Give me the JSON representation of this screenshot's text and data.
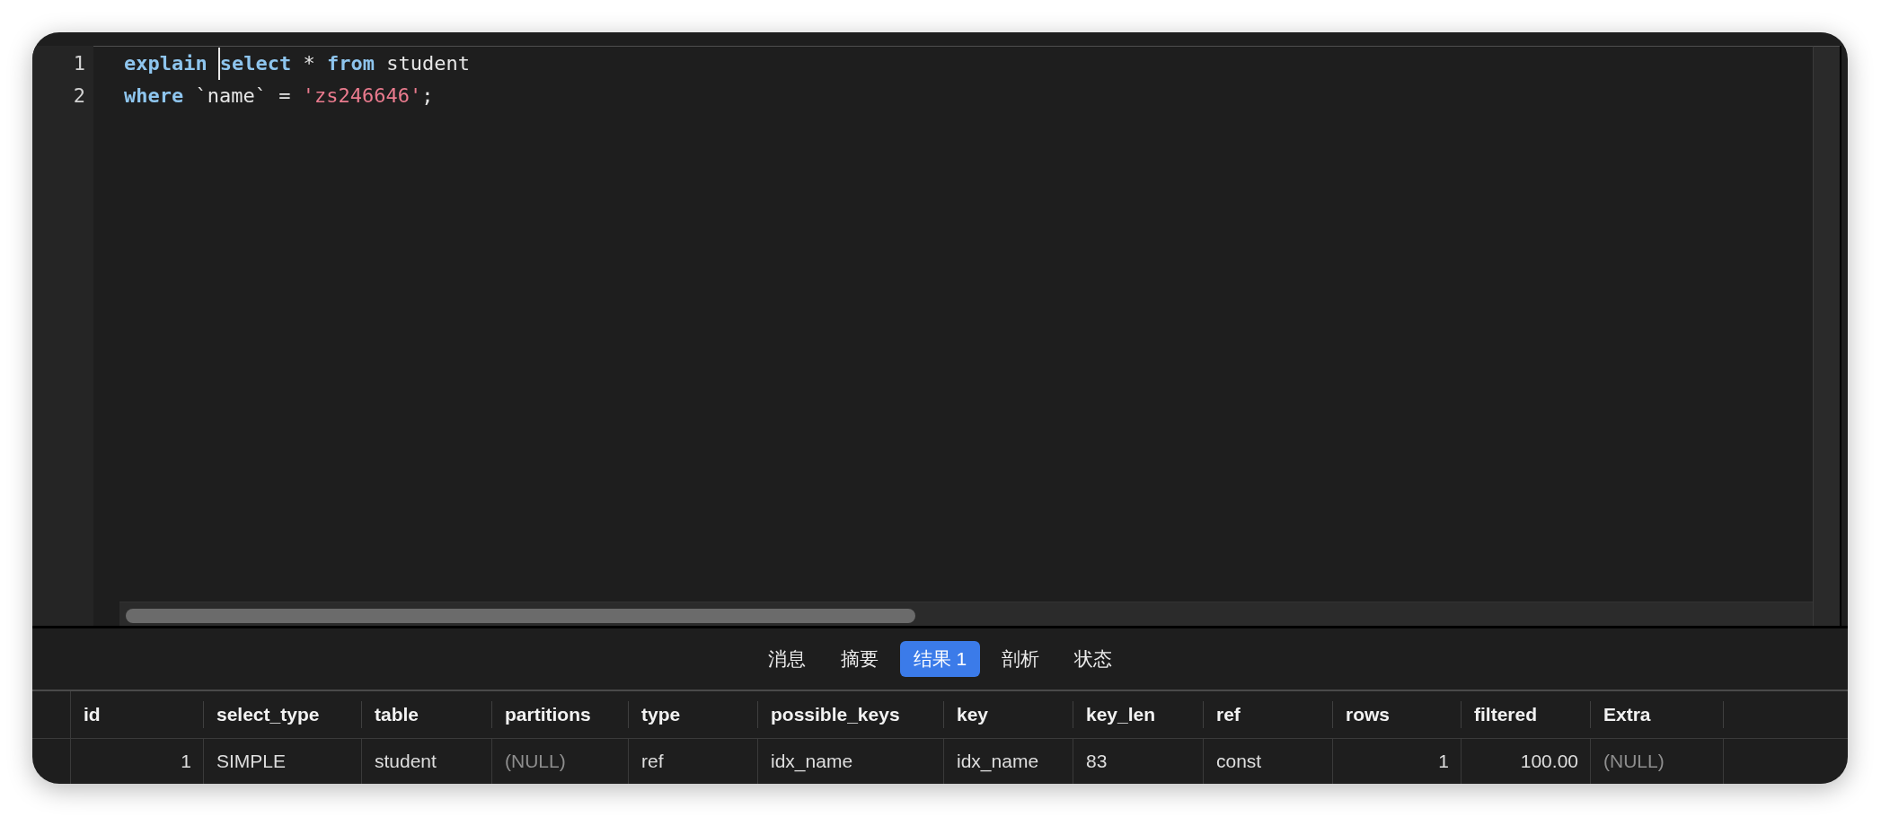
{
  "editor": {
    "lines": [
      {
        "number": "1",
        "tokens": [
          {
            "kind": "keyword",
            "text": "explain"
          },
          {
            "kind": "cursor"
          },
          {
            "kind": "keyword",
            "text": "select"
          },
          {
            "kind": "plain",
            "text": " * "
          },
          {
            "kind": "keyword",
            "text": "from"
          },
          {
            "kind": "plain",
            "text": " student"
          }
        ]
      },
      {
        "number": "2",
        "tokens": [
          {
            "kind": "keyword",
            "text": "where"
          },
          {
            "kind": "plain",
            "text": " `name` = "
          },
          {
            "kind": "string",
            "text": "'zs246646'"
          },
          {
            "kind": "plain",
            "text": ";"
          }
        ]
      }
    ]
  },
  "tabs": [
    {
      "label": "消息",
      "selected": false
    },
    {
      "label": "摘要",
      "selected": false
    },
    {
      "label": "结果 1",
      "selected": true
    },
    {
      "label": "剖析",
      "selected": false
    },
    {
      "label": "状态",
      "selected": false
    }
  ],
  "result_table": {
    "columns": [
      {
        "label": "id",
        "kind": "number"
      },
      {
        "label": "select_type",
        "kind": "text"
      },
      {
        "label": "table",
        "kind": "text"
      },
      {
        "label": "partitions",
        "kind": "text"
      },
      {
        "label": "type",
        "kind": "text"
      },
      {
        "label": "possible_keys",
        "kind": "text"
      },
      {
        "label": "key",
        "kind": "text"
      },
      {
        "label": "key_len",
        "kind": "text"
      },
      {
        "label": "ref",
        "kind": "text"
      },
      {
        "label": "rows",
        "kind": "number"
      },
      {
        "label": "filtered",
        "kind": "number"
      },
      {
        "label": "Extra",
        "kind": "text"
      }
    ],
    "rows": [
      {
        "cells": [
          {
            "text": "1",
            "is_null": false
          },
          {
            "text": "SIMPLE",
            "is_null": false
          },
          {
            "text": "student",
            "is_null": false
          },
          {
            "text": "(NULL)",
            "is_null": true
          },
          {
            "text": "ref",
            "is_null": false
          },
          {
            "text": "idx_name",
            "is_null": false
          },
          {
            "text": "idx_name",
            "is_null": false
          },
          {
            "text": "83",
            "is_null": false
          },
          {
            "text": "const",
            "is_null": false
          },
          {
            "text": "1",
            "is_null": false
          },
          {
            "text": "100.00",
            "is_null": false
          },
          {
            "text": "(NULL)",
            "is_null": true
          }
        ]
      }
    ]
  }
}
